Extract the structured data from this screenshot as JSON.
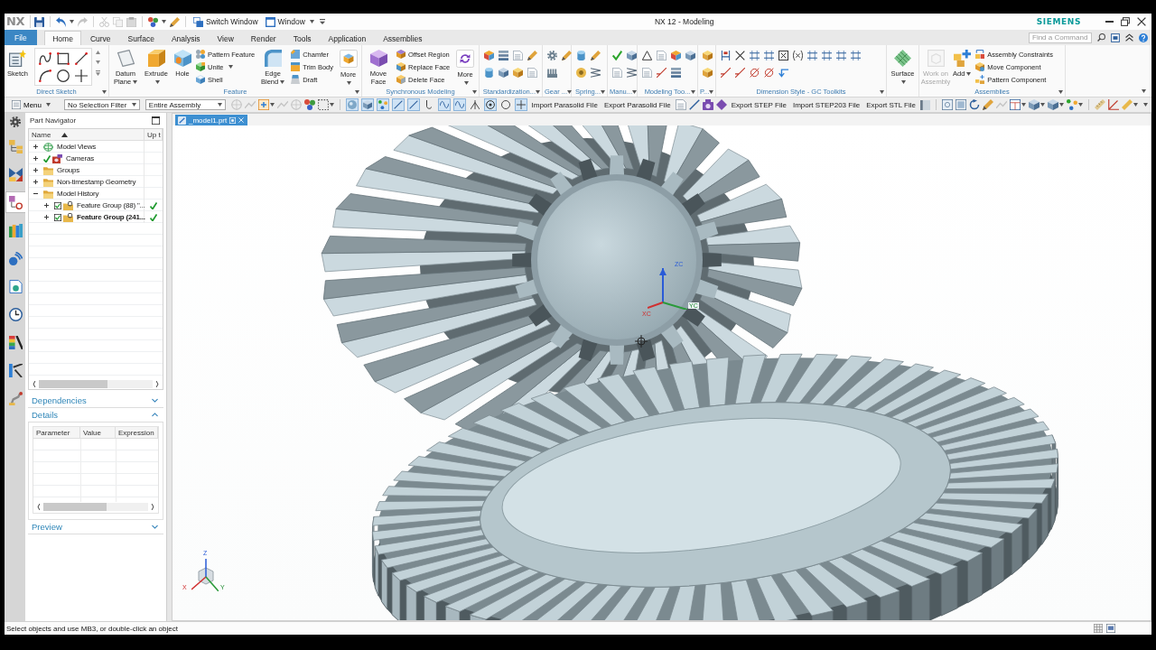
{
  "title_bar": {
    "logo": "NX",
    "quick_access": [
      {
        "label": "Switch Window",
        "dropdown": false
      },
      {
        "label": "Window",
        "dropdown": true
      }
    ],
    "title": "NX 12 - Modeling",
    "brand": "SIEMENS"
  },
  "menu_tabs": [
    {
      "label": "File",
      "kind": "file",
      "selected": false
    },
    {
      "label": "Home",
      "kind": "tab",
      "selected": true
    },
    {
      "label": "Curve",
      "kind": "tab",
      "selected": false
    },
    {
      "label": "Surface",
      "kind": "tab",
      "selected": false
    },
    {
      "label": "Analysis",
      "kind": "tab",
      "selected": false
    },
    {
      "label": "View",
      "kind": "tab",
      "selected": false
    },
    {
      "label": "Render",
      "kind": "tab",
      "selected": false
    },
    {
      "label": "Tools",
      "kind": "tab",
      "selected": false
    },
    {
      "label": "Application",
      "kind": "tab",
      "selected": false
    },
    {
      "label": "Assemblies",
      "kind": "tab",
      "selected": false
    }
  ],
  "command_search": {
    "placeholder": "Find a Command"
  },
  "ribbon": [
    {
      "label": "Direct Sketch",
      "menu": true,
      "items": [
        {
          "kind": "large",
          "label": "Sketch",
          "dropdown": false
        },
        {
          "kind": "sketch_tools"
        }
      ]
    },
    {
      "label": "Feature",
      "menu": true,
      "items": [
        {
          "kind": "large",
          "label": "Datum Plane",
          "dropdown": true
        },
        {
          "kind": "large",
          "label": "Extrude",
          "dropdown": true
        },
        {
          "kind": "large",
          "label": "Hole",
          "dropdown": false
        },
        {
          "kind": "list",
          "entries": [
            {
              "label": "Pattern Feature",
              "dropdown": false
            },
            {
              "label": "Unite",
              "dropdown": true
            },
            {
              "label": "Shell",
              "dropdown": false
            }
          ]
        },
        {
          "kind": "large",
          "label": "Edge Blend",
          "dropdown": true
        },
        {
          "kind": "list",
          "entries": [
            {
              "label": "Chamfer",
              "dropdown": false
            },
            {
              "label": "Trim Body",
              "dropdown": false
            },
            {
              "label": "Draft",
              "dropdown": false
            }
          ]
        },
        {
          "kind": "overflow",
          "label": "More",
          "dropdown": true
        }
      ]
    },
    {
      "label": "Synchronous Modeling",
      "menu": true,
      "items": [
        {
          "kind": "large",
          "label": "Move Face",
          "dropdown": false
        },
        {
          "kind": "list",
          "entries": [
            {
              "label": "Offset Region",
              "dropdown": false
            },
            {
              "label": "Replace Face",
              "dropdown": false
            },
            {
              "label": "Delete Face",
              "dropdown": false
            }
          ]
        },
        {
          "kind": "overflow",
          "label": "More",
          "dropdown": true
        }
      ]
    },
    {
      "label": "Standardization...",
      "menu": true,
      "items": [
        {
          "kind": "icon_grid"
        }
      ]
    },
    {
      "label": "Gear ...",
      "menu": true,
      "items": [
        {
          "kind": "icon_grid"
        }
      ]
    },
    {
      "label": "Spring...",
      "menu": true,
      "items": [
        {
          "kind": "icon_grid"
        }
      ]
    },
    {
      "label": "Manu...",
      "menu": true,
      "items": [
        {
          "kind": "icon_grid"
        }
      ]
    },
    {
      "label": "Modeling Too...",
      "menu": true,
      "items": [
        {
          "kind": "icon_grid"
        }
      ]
    },
    {
      "label": "P...",
      "menu": true,
      "items": [
        {
          "kind": "icon_grid"
        }
      ]
    },
    {
      "label": "Dimension Style - GC Toolkits",
      "menu": true,
      "items": [
        {
          "kind": "icon_grid"
        }
      ]
    },
    {
      "items": [
        {
          "kind": "large",
          "label": "Surface",
          "dropdown": true
        }
      ]
    },
    {
      "label": "Assemblies",
      "menu": true,
      "items": [
        {
          "kind": "large",
          "label": "Work on Assembly",
          "dropdown": false,
          "disabled": true
        },
        {
          "kind": "large",
          "label": "Add",
          "dropdown": true,
          "disabled": false
        },
        {
          "kind": "list",
          "entries": [
            {
              "label": "Assembly Constraints",
              "dropdown": false
            },
            {
              "label": "Move Component",
              "dropdown": false
            },
            {
              "label": "Pattern Component",
              "dropdown": false
            }
          ]
        }
      ]
    }
  ],
  "toolbar": {
    "menu": {
      "label": "Menu",
      "dropdown": true
    },
    "selection_filter": {
      "value": "No Selection Filter"
    },
    "assembly_scope": {
      "value": "Entire Assembly"
    },
    "toggles": [
      {
        "on": true
      },
      {
        "on": true
      },
      {
        "on": true
      },
      {
        "on": true
      },
      {
        "on": true
      },
      {
        "on": false
      },
      {
        "on": true
      },
      {
        "on": true
      },
      {
        "on": false
      },
      {
        "on": true
      },
      {
        "on": false
      },
      {
        "on": true
      }
    ],
    "commands": [
      "Import Parasolid File",
      "Export Parasolid File",
      "Export STEP File",
      "Import STEP203 File",
      "Export STL File"
    ]
  },
  "side_rail": [
    {
      "selected": false
    },
    {
      "selected": false
    },
    {
      "selected": true
    },
    {
      "selected": false
    },
    {
      "selected": false
    },
    {
      "selected": false
    },
    {
      "selected": false
    },
    {
      "selected": false
    },
    {
      "selected": false
    },
    {
      "selected": false
    }
  ],
  "part_navigator": {
    "title": "Part Navigator",
    "columns": [
      {
        "label": "Name",
        "sorted": true
      },
      {
        "label": "Up t",
        "sorted": false
      }
    ],
    "tree": [
      {
        "label": "Model Views",
        "kind": "views",
        "expanded": false,
        "checked": false
      },
      {
        "label": "Cameras",
        "kind": "cameras",
        "expanded": false,
        "checked": true
      },
      {
        "label": "Groups",
        "kind": "folder",
        "expanded": false,
        "checked": false
      },
      {
        "label": "Non-timestamp Geometry",
        "kind": "folder",
        "expanded": false,
        "checked": false
      },
      {
        "label": "Model History",
        "kind": "folder",
        "expanded": true,
        "checked": false,
        "children": [
          {
            "label": "Feature Group (88) \"...",
            "kind": "feature_group",
            "expanded": false,
            "checked": true,
            "up_to_date": true,
            "current": false
          },
          {
            "label": "Feature Group (241...",
            "kind": "feature_group",
            "expanded": false,
            "checked": true,
            "up_to_date": true,
            "current": true
          }
        ]
      }
    ],
    "sections": [
      {
        "title": "Dependencies",
        "expanded": false
      },
      {
        "title": "Details",
        "expanded": true,
        "columns": [
          "Parameter",
          "Value",
          "Expression"
        ]
      },
      {
        "title": "Preview",
        "expanded": false
      }
    ]
  },
  "viewport": {
    "tabs": [
      {
        "label": "_model1.prt",
        "selected": true
      }
    ],
    "csys_labels": [
      "ZC",
      "XC",
      "YC"
    ],
    "view_triad_labels": [
      "Z",
      "X",
      "Y"
    ]
  },
  "status_bar": {
    "message": "Select objects and use MB3, or double-click an object"
  }
}
